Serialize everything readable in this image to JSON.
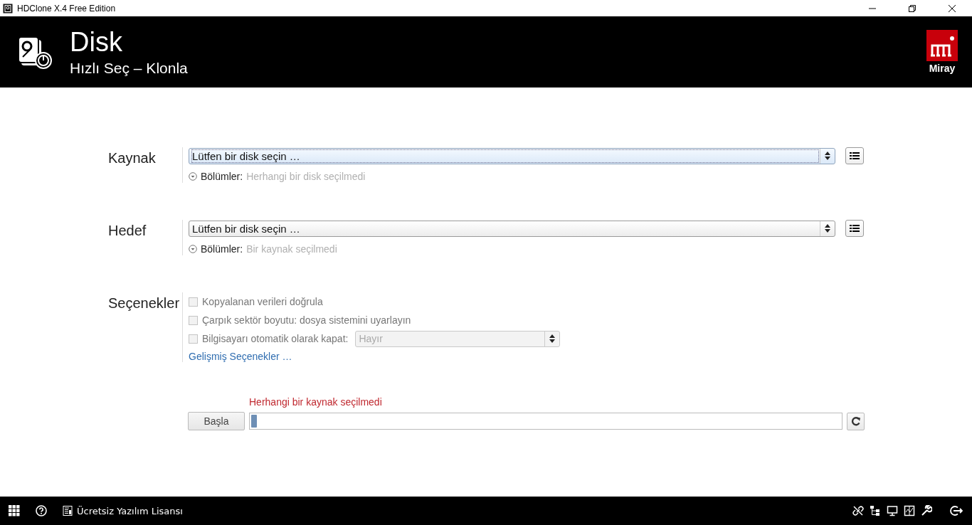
{
  "window": {
    "title": "HDClone X.4 Free Edition"
  },
  "header": {
    "title": "Disk",
    "subtitle": "Hızlı Seç – Klonla",
    "brand": "Miray"
  },
  "disks": [
    {
      "label": "Kaynak",
      "value": "Lütfen bir disk seçin …",
      "focused": true,
      "partitions_label": "Bölümler:",
      "partitions_value": "Herhangi bir disk seçilmedi"
    },
    {
      "label": "Hedef",
      "value": "Lütfen bir disk seçin …",
      "focused": false,
      "partitions_label": "Bölümler:",
      "partitions_value": "Bir kaynak seçilmedi"
    }
  ],
  "options": {
    "label": "Seçenekler",
    "items": [
      {
        "kind": "checkbox",
        "label": "Kopyalanan verileri doğrula",
        "checked": false,
        "disabled": true
      },
      {
        "kind": "checkbox",
        "label": "Çarpık sektör boyutu: dosya sistemini uyarlayın",
        "checked": false,
        "disabled": true
      },
      {
        "kind": "checkbox-select",
        "label": "Bilgisayarı otomatik olarak kapat:",
        "checked": false,
        "disabled": true,
        "select_value": "Hayır"
      }
    ],
    "link": "Gelişmiş Seçenekler …"
  },
  "start": {
    "message": "Herhangi bir kaynak seçilmedi",
    "button": "Başla",
    "level": 0.01
  },
  "footer": {
    "license": "Ücretsiz Yazılım Lisansı"
  }
}
